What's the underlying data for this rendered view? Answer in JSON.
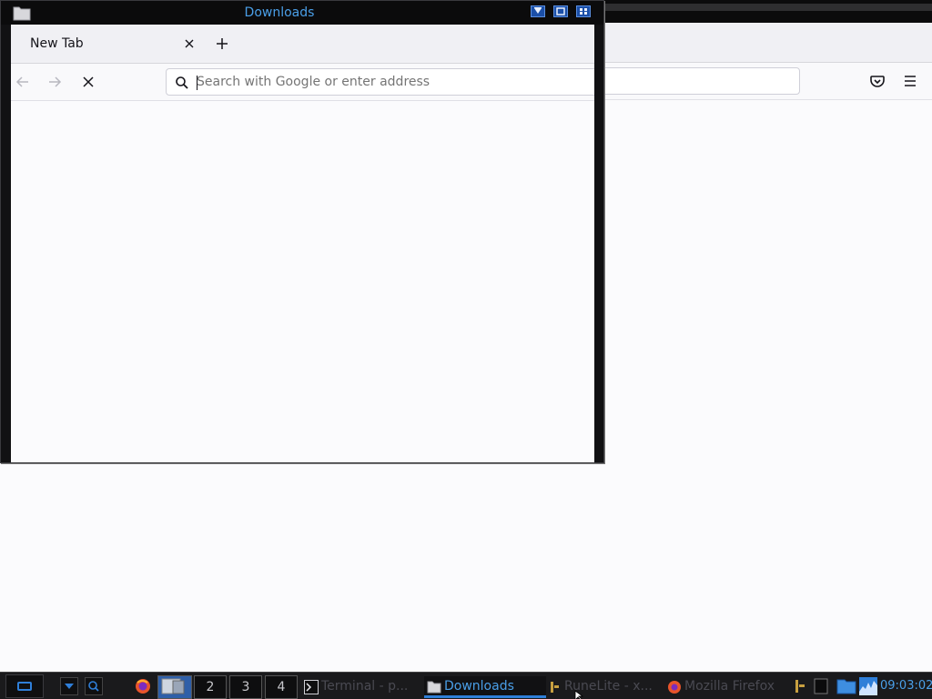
{
  "window": {
    "title": "Downloads"
  },
  "browser": {
    "tab": {
      "label": "New Tab"
    },
    "urlbar": {
      "placeholder": "Search with Google or enter address",
      "value": ""
    }
  },
  "taskbar": {
    "workspaces": [
      "2",
      "3",
      "4"
    ],
    "tasks": [
      {
        "label": "Terminal - p...",
        "icon": "terminal-icon"
      },
      {
        "label": "Downloads",
        "icon": "folder-icon"
      },
      {
        "label": "RuneLite - x...",
        "icon": "runelite-icon"
      },
      {
        "label": "Mozilla Firefox",
        "icon": "firefox-icon"
      }
    ],
    "clock": "09:03:02"
  },
  "colors": {
    "accent": "#4a9fe8",
    "titlebar": "#0b0b0c",
    "page_bg": "#fbfbfd"
  }
}
